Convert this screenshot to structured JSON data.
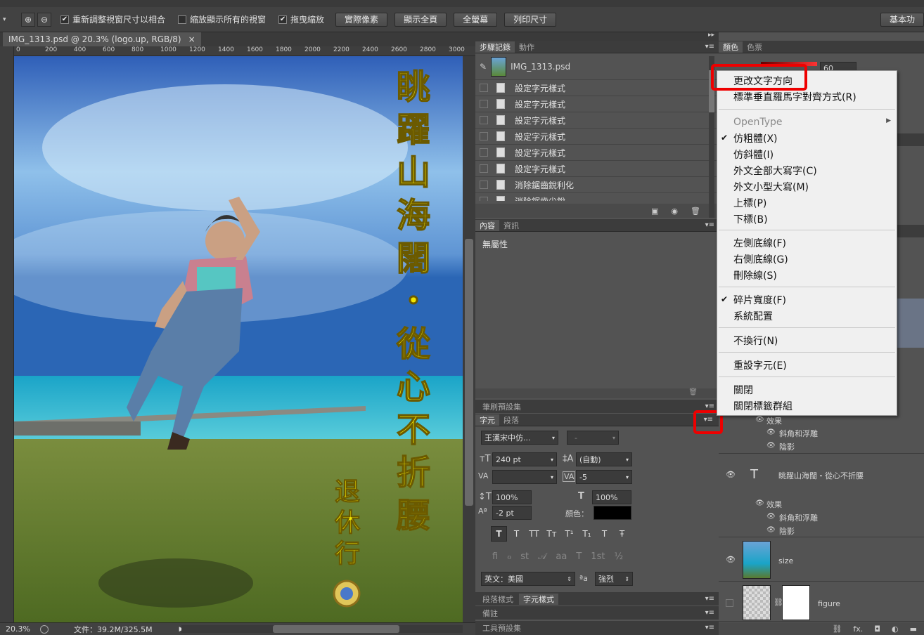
{
  "options_bar": {
    "resize_label": "重新調整視窗尺寸以相合",
    "zoom_all_label": "縮放顯示所有的視窗",
    "scrubby_label": "拖曳縮放",
    "btn_actual": "實際像素",
    "btn_fit": "顯示全頁",
    "btn_fill": "全螢幕",
    "btn_print": "列印尺寸",
    "workspace": "基本功"
  },
  "document": {
    "tab_title": "IMG_1313.psd @ 20.3% (logo.up, RGB/8)",
    "close": "×",
    "ruler_ticks": [
      "0",
      "200",
      "400",
      "600",
      "800",
      "1000",
      "1200",
      "1400",
      "1600",
      "1800",
      "2000",
      "2200",
      "2400",
      "2600",
      "2800",
      "3000"
    ],
    "canvas_text": [
      "眺",
      "躍",
      "山",
      "海",
      "闊",
      "・",
      "從",
      "心",
      "不",
      "折",
      "腰"
    ],
    "canvas_text_small": [
      "退",
      "休",
      "行"
    ],
    "zoom": "20.3%",
    "file_info": "文件：39.2M/325.5M"
  },
  "history": {
    "tabs": [
      "步驟記錄",
      "動作"
    ],
    "snapshot": "IMG_1313.psd",
    "items": [
      "設定字元樣式",
      "設定字元樣式",
      "設定字元樣式",
      "設定字元樣式",
      "設定字元樣式",
      "設定字元樣式",
      "消除鋸齒銳利化",
      "消除鋸齒尖銳"
    ]
  },
  "properties": {
    "tabs": [
      "內容",
      "資訊"
    ],
    "text": "無屬性"
  },
  "brush_presets": {
    "tab": "筆刷預設集"
  },
  "character": {
    "tabs": [
      "字元",
      "段落"
    ],
    "font": "王漢宋中仿...",
    "style": "-",
    "size": "240 pt",
    "leading": "(自動)",
    "kerning": "",
    "tracking": "-5",
    "vscale": "100%",
    "hscale": "100%",
    "baseline": "-2 pt",
    "color_label": "顏色：",
    "language": "英文：美國",
    "aa_label": "a",
    "antialias": "強烈",
    "style_buttons": [
      "T",
      "T",
      "TT",
      "Tт",
      "T¹",
      "T₁",
      "T",
      "Ŧ"
    ]
  },
  "bottom_tabs": {
    "paragraph_styles": "段落樣式",
    "char_styles": "字元樣式",
    "notes": "備註",
    "tool_presets": "工具預設集"
  },
  "color_panel": {
    "tabs": [
      "顏色",
      "色票"
    ],
    "value": "60"
  },
  "context_menu": {
    "items": [
      {
        "label": "更改文字方向",
        "checked": false,
        "submenu": false,
        "disabled": false
      },
      {
        "label": "標準垂直羅馬字對齊方式(R)",
        "checked": false,
        "submenu": false,
        "disabled": false
      },
      {
        "label": "OpenType",
        "checked": false,
        "submenu": true,
        "disabled": true
      },
      {
        "label": "仿粗體(X)",
        "checked": true,
        "submenu": false,
        "disabled": false
      },
      {
        "label": "仿斜體(I)",
        "checked": false,
        "submenu": false,
        "disabled": false
      },
      {
        "label": "外文全部大寫字(C)",
        "checked": false,
        "submenu": false,
        "disabled": false
      },
      {
        "label": "外文小型大寫(M)",
        "checked": false,
        "submenu": false,
        "disabled": false
      },
      {
        "label": "上標(P)",
        "checked": false,
        "submenu": false,
        "disabled": false
      },
      {
        "label": "下標(B)",
        "checked": false,
        "submenu": false,
        "disabled": false
      },
      {
        "label": "左側底線(F)",
        "checked": false,
        "submenu": false,
        "disabled": false
      },
      {
        "label": "右側底線(G)",
        "checked": false,
        "submenu": false,
        "disabled": false
      },
      {
        "label": "刪除線(S)",
        "checked": false,
        "submenu": false,
        "disabled": false
      },
      {
        "label": "碎片寬度(F)",
        "checked": true,
        "submenu": false,
        "disabled": false
      },
      {
        "label": "系統配置",
        "checked": false,
        "submenu": false,
        "disabled": false
      },
      {
        "label": "不換行(N)",
        "checked": false,
        "submenu": false,
        "disabled": false
      },
      {
        "label": "重設字元(E)",
        "checked": false,
        "submenu": false,
        "disabled": false
      },
      {
        "label": "關閉",
        "checked": false,
        "submenu": false,
        "disabled": false
      },
      {
        "label": "關閉標籤群組",
        "checked": false,
        "submenu": false,
        "disabled": false
      }
    ]
  },
  "layers": {
    "effects_label": "效果",
    "bevel": "斜角和浮雕",
    "shadow": "陰影",
    "text_layer": "眺躍山海闊・從心不折腰",
    "size_layer": "size",
    "figure_layer": "figure",
    "text_thumb": "T"
  },
  "colors": {
    "highlight": "#ee0000",
    "caption_yellow": "#f2e600"
  }
}
